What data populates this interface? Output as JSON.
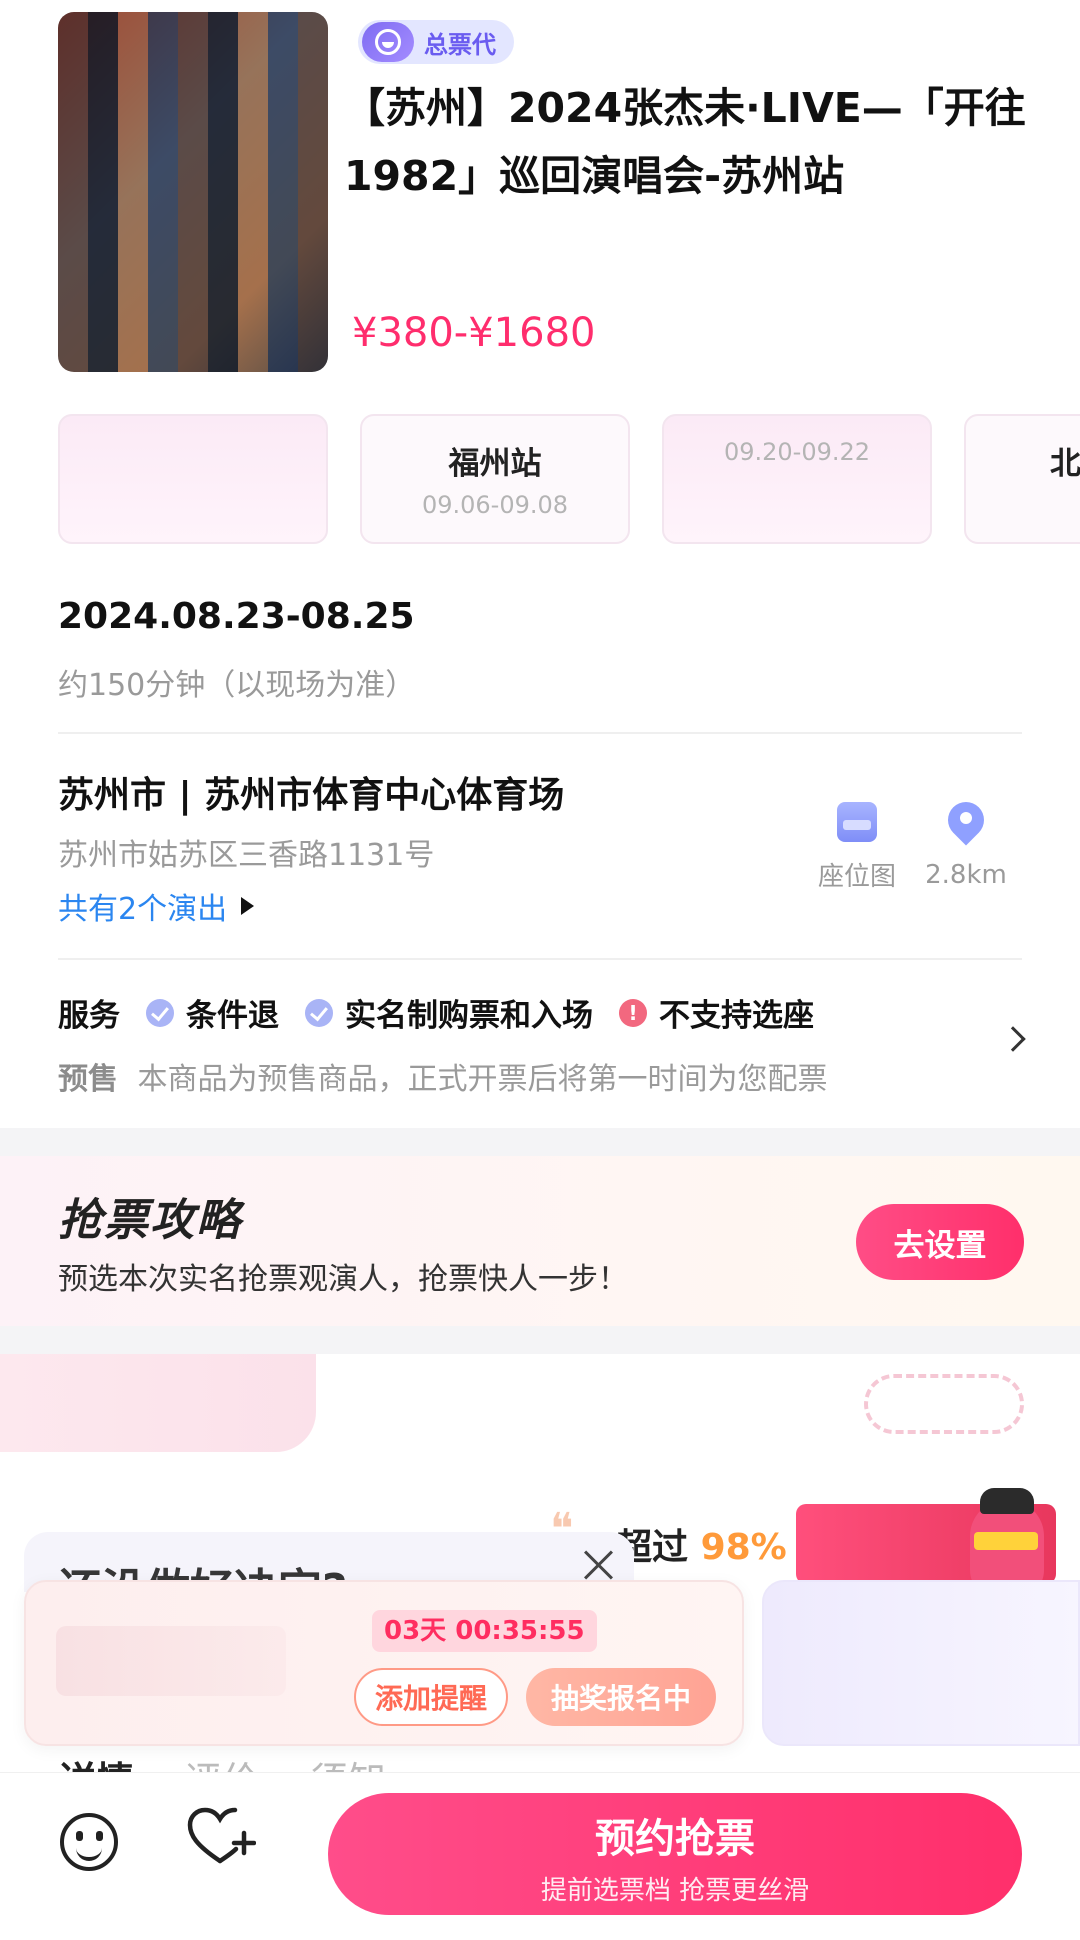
{
  "product": {
    "badge": "总票代",
    "title": "【苏州】2024张杰未·LIVE—「开往1982」巡回演唱会-苏州站",
    "price": "¥380-¥1680"
  },
  "stations": [
    {
      "city": "",
      "date": ""
    },
    {
      "city": "福州站",
      "date": "09.06-09.08"
    },
    {
      "city": "",
      "date": "09.20-09.22"
    },
    {
      "city": "北",
      "date": ""
    }
  ],
  "event": {
    "date": "2024.08.23-08.25",
    "duration": "约150分钟（以现场为准）"
  },
  "venue": {
    "name": "苏州市 | 苏州市体育中心体育场",
    "address": "苏州市姑苏区三香路1131号",
    "shows": "共有2个演出",
    "seatmap_label": "座位图",
    "distance": "2.8km"
  },
  "services": {
    "head": "服务",
    "items": [
      {
        "label": "条件退",
        "status": "ok"
      },
      {
        "label": "实名制购票和入场",
        "status": "ok"
      },
      {
        "label": "不支持选座",
        "status": "warn"
      }
    ],
    "presale_tag": "预售",
    "presale_text": "本商品为预售商品，正式开票后将第一时间为您配票"
  },
  "strategy": {
    "title": "抢票攻略",
    "desc": "预选本次实名抢票观演人，抢票快人一步！",
    "button": "去设置"
  },
  "promo": {
    "exceed_prefix": "超过",
    "exceed_pct": "98%",
    "ghost_title": "还没做好决定?"
  },
  "lottery_card": {
    "countdown": "03天 00:35:55",
    "remind_button": "添加提醒",
    "lottery_button": "抽奖报名中"
  },
  "tabs": [
    "详情",
    "评价",
    "须知"
  ],
  "bottom": {
    "reserve_main": "预约抢票",
    "reserve_sub": "提前选票档 抢票更丝滑"
  },
  "colors": {
    "accent": "#ff2f6b",
    "price": "#ff2d6d",
    "link": "#2b86f0",
    "badge_bg": "#e3e6ff",
    "badge_text": "#6a5cf0"
  }
}
